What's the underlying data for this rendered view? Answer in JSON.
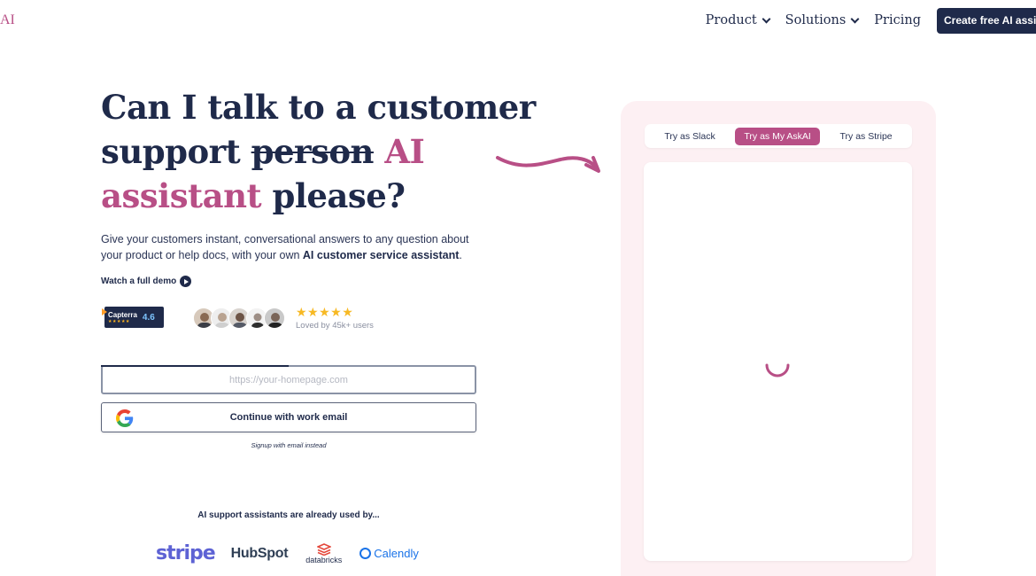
{
  "brand": {
    "logo_text": "AI",
    "accent_color": "#b84f86",
    "primary_color": "#1f2a4a"
  },
  "nav": {
    "items": [
      {
        "label": "Product",
        "has_dropdown": true
      },
      {
        "label": "Solutions",
        "has_dropdown": true
      },
      {
        "label": "Pricing",
        "has_dropdown": false
      }
    ],
    "cta_label": "Create free AI assistant"
  },
  "hero": {
    "headline_part1": "Can I talk to a customer support ",
    "headline_strike": "person",
    "headline_accent": " AI assistant",
    "headline_part2": " please?",
    "sub_text": "Give your customers instant, conversational answers to any question about your product or help docs, with your own ",
    "sub_bold": "AI customer service assistant",
    "sub_end": ".",
    "demo_label": "Watch a full demo"
  },
  "social_proof": {
    "capterra_name": "Capterra",
    "capterra_score": "4.6",
    "stars": "★★★★★",
    "loved_text": "Loved by 45k+ users"
  },
  "form": {
    "url_placeholder": "https://your-homepage.com",
    "google_button_label": "Continue with work email",
    "email_link": "Signup with email instead"
  },
  "used_by": {
    "heading": "AI support assistants are already used by...",
    "logos": [
      "stripe",
      "HubSpot",
      "databricks",
      "Calendly"
    ]
  },
  "demo_panel": {
    "tabs": [
      {
        "label": "Try as Slack",
        "active": false
      },
      {
        "label": "Try as My AskAI",
        "active": true
      },
      {
        "label": "Try as Stripe",
        "active": false
      }
    ],
    "loading": true
  }
}
